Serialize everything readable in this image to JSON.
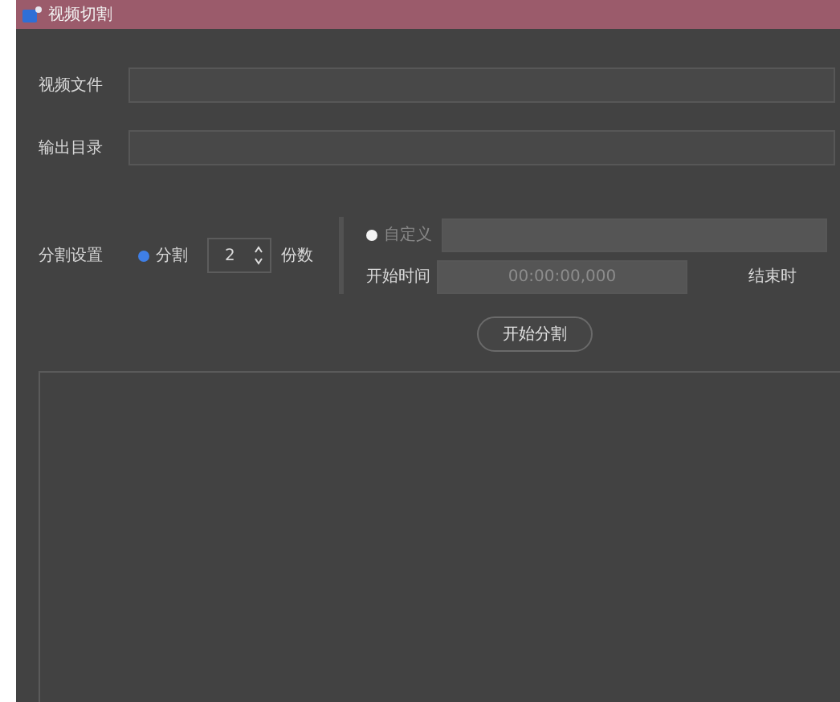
{
  "window": {
    "title": "视频切割"
  },
  "fields": [
    {
      "label": "视频文件"
    },
    {
      "label": "输出目录"
    }
  ],
  "split_settings": {
    "label": "分割设置",
    "modes": [
      {
        "label": "分割",
        "selected": true
      },
      {
        "label": "自定义",
        "selected": false
      }
    ],
    "count": {
      "value": "2",
      "unit": "份数"
    },
    "start_time": {
      "label": "开始时间",
      "value": "00:00:00,000"
    },
    "end_time": {
      "label": "结束时"
    }
  },
  "start_button": "开始分割"
}
